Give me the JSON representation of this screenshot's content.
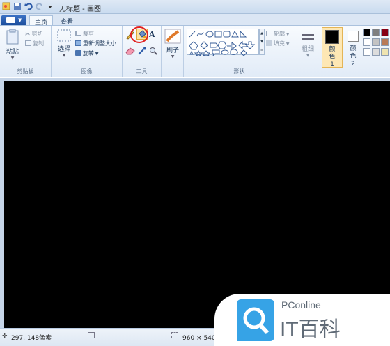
{
  "window": {
    "title": "无标题 - 画图"
  },
  "tabs": [
    {
      "label": "主页"
    },
    {
      "label": "查看"
    }
  ],
  "clipboard": {
    "paste": "粘贴",
    "cut": "剪切",
    "copy": "复制",
    "label": "剪贴板"
  },
  "image": {
    "select": "选择",
    "crop": "裁剪",
    "resize": "重新调整大小",
    "rotate": "旋转",
    "label": "图像"
  },
  "tools": {
    "label": "工具"
  },
  "brushes": {
    "label": "刷子"
  },
  "shapes": {
    "outline": "轮廓",
    "fill": "填充",
    "label": "形状"
  },
  "size": {
    "label": "粗细"
  },
  "colors": {
    "color1": "颜色 1",
    "color2": "颜色 2",
    "color1_value": "#000000",
    "color2_value": "#ffffff",
    "palette": [
      "#000000",
      "#7f7f7f",
      "#880015",
      "#ffffff",
      "#c3c3c3",
      "#b97a57",
      "#ffffff",
      "#dcdcdc",
      "#efe4b0"
    ]
  },
  "status": {
    "position": "297, 148像素",
    "canvas_size": "960 × 540像"
  },
  "watermark": {
    "brand": "PConline",
    "text": "IT百科"
  },
  "accent": "#1d4e9d"
}
